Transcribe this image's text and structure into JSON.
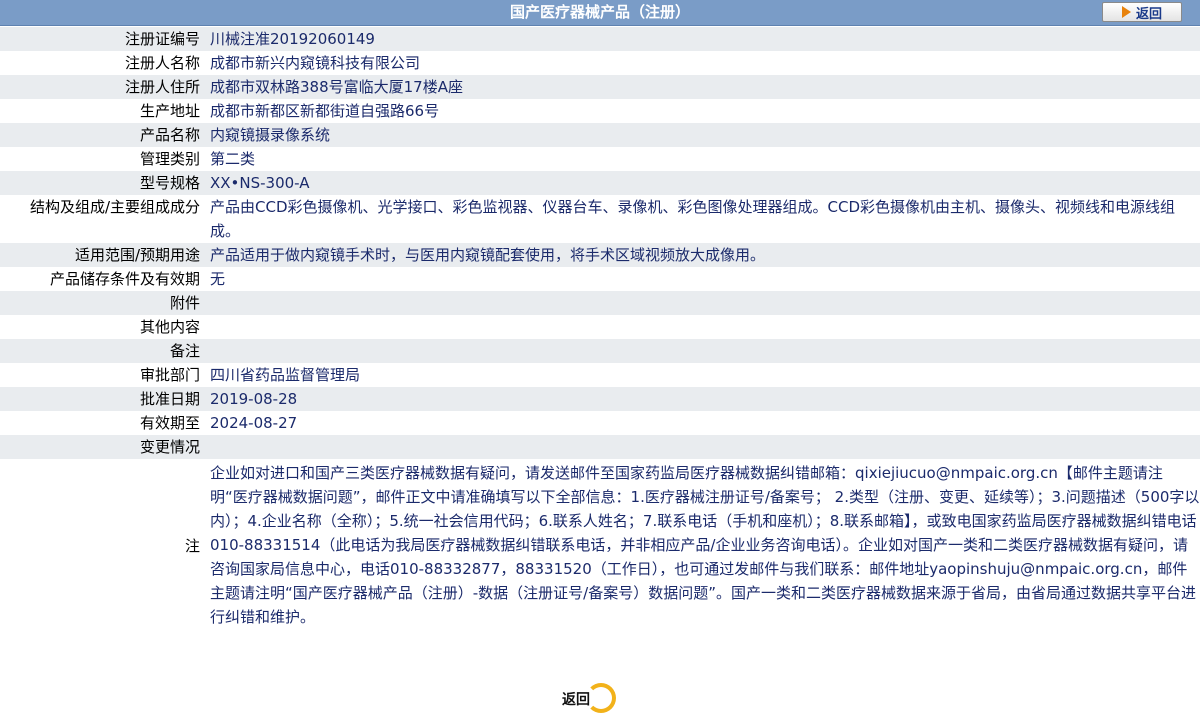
{
  "header": {
    "title": "国产医疗器械产品（注册）",
    "back_label": "返回"
  },
  "rows": [
    {
      "label": "注册证编号",
      "value": "川械注准20192060149"
    },
    {
      "label": "注册人名称",
      "value": "成都市新兴内窥镜科技有限公司"
    },
    {
      "label": "注册人住所",
      "value": "成都市双林路388号富临大厦17楼A座"
    },
    {
      "label": "生产地址",
      "value": "成都市新都区新都街道自强路66号"
    },
    {
      "label": "产品名称",
      "value": "内窥镜摄录像系统"
    },
    {
      "label": "管理类别",
      "value": "第二类"
    },
    {
      "label": "型号规格",
      "value": "XX•NS-300-A"
    },
    {
      "label": "结构及组成/主要组成成分",
      "value": "产品由CCD彩色摄像机、光学接口、彩色监视器、仪器台车、录像机、彩色图像处理器组成。CCD彩色摄像机由主机、摄像头、视频线和电源线组成。"
    },
    {
      "label": "适用范围/预期用途",
      "value": "产品适用于做内窥镜手术时，与医用内窥镜配套使用，将手术区域视频放大成像用。"
    },
    {
      "label": "产品储存条件及有效期",
      "value": "无"
    },
    {
      "label": "附件",
      "value": ""
    },
    {
      "label": "其他内容",
      "value": ""
    },
    {
      "label": "备注",
      "value": ""
    },
    {
      "label": "审批部门",
      "value": "四川省药品监督管理局"
    },
    {
      "label": "批准日期",
      "value": "2019-08-28"
    },
    {
      "label": "有效期至",
      "value": "2024-08-27"
    },
    {
      "label": "变更情况",
      "value": ""
    }
  ],
  "note": {
    "label": "注",
    "text": "企业如对进口和国产三类医疗器械数据有疑问，请发送邮件至国家药监局医疗器械数据纠错邮箱：qixiejiucuo@nmpaic.org.cn【邮件主题请注明“医疗器械数据问题”，邮件正文中请准确填写以下全部信息：1.医疗器械注册证号/备案号； 2.类型（注册、变更、延续等）；3.问题描述（500字以内）；4.企业名称（全称）；5.统一社会信用代码；6.联系人姓名；7.联系电话（手机和座机）；8.联系邮箱】，或致电国家药监局医疗器械数据纠错电话010-88331514（此电话为我局医疗器械数据纠错联系电话，并非相应产品/企业业务咨询电话）。企业如对国产一类和二类医疗器械数据有疑问，请咨询国家局信息中心，电话010-88332877，88331520（工作日），也可通过发邮件与我们联系：邮件地址yaopinshuju@nmpaic.org.cn，邮件主题请注明“国产医疗器械产品（注册）-数据（注册证号/备案号）数据问题”。国产一类和二类医疗器械数据来源于省局，由省局通过数据共享平台进行纠错和维护。"
  },
  "footer": {
    "back_label": "返回"
  },
  "colors": {
    "header_bg": "#7a9cc7",
    "row_alt_bg": "#e9ecef",
    "value_text": "#1b2a6b",
    "back_icon": "#e8820c"
  }
}
